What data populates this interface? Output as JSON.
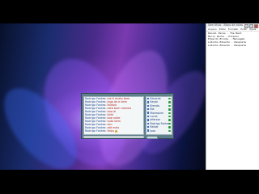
{
  "chat": {
    "messages": [
      {
        "name": "Rodrigo Fontes",
        "text": "ele é muito bom"
      },
      {
        "name": "Rodrigo Fontes",
        "text": "jogo do e bem"
      },
      {
        "name": "Rodrigo Fontes",
        "text": "kkkkkk"
      },
      {
        "name": "Rodrigo Fontes",
        "text": "está bom mesmo"
      },
      {
        "name": "Rodrigo Fontes",
        "text": "isso ai"
      },
      {
        "name": "Rodrigo Fontes",
        "text": "kkkk"
      },
      {
        "name": "Rodrigo Fontes",
        "text": "boa noite"
      },
      {
        "name": "Rodrigo Fontes",
        "text": "tudo bem"
      },
      {
        "name": "Rodrigo Fontes",
        "text": "sim"
      },
      {
        "name": "Rodrigo Fontes",
        "text": "até mais"
      },
      {
        "name": "Rodrigo Fontes",
        "text": "falou"
      }
    ],
    "users": [
      "Eduardo",
      "Kayan",
      "Brenda",
      "Bia",
      "Manequim",
      "Lucas",
      "Jeferson",
      "Rodrigo Fontes",
      "Rafael",
      "Joao"
    ]
  },
  "notepad": {
    "title": "Sem título - Bloco de notas",
    "menu": [
      "Arquivo",
      "Editar",
      "Formatar",
      "Exibir",
      "Ajuda"
    ],
    "lines": [
      "Daniel Peres - The Best",
      "Mario Rocha - Pikachu",
      "Eduardo Brooks - Mensagem",
      "Lobinho Eduardo - Resposta",
      "Lobinho Eduardo - Resposta"
    ]
  }
}
